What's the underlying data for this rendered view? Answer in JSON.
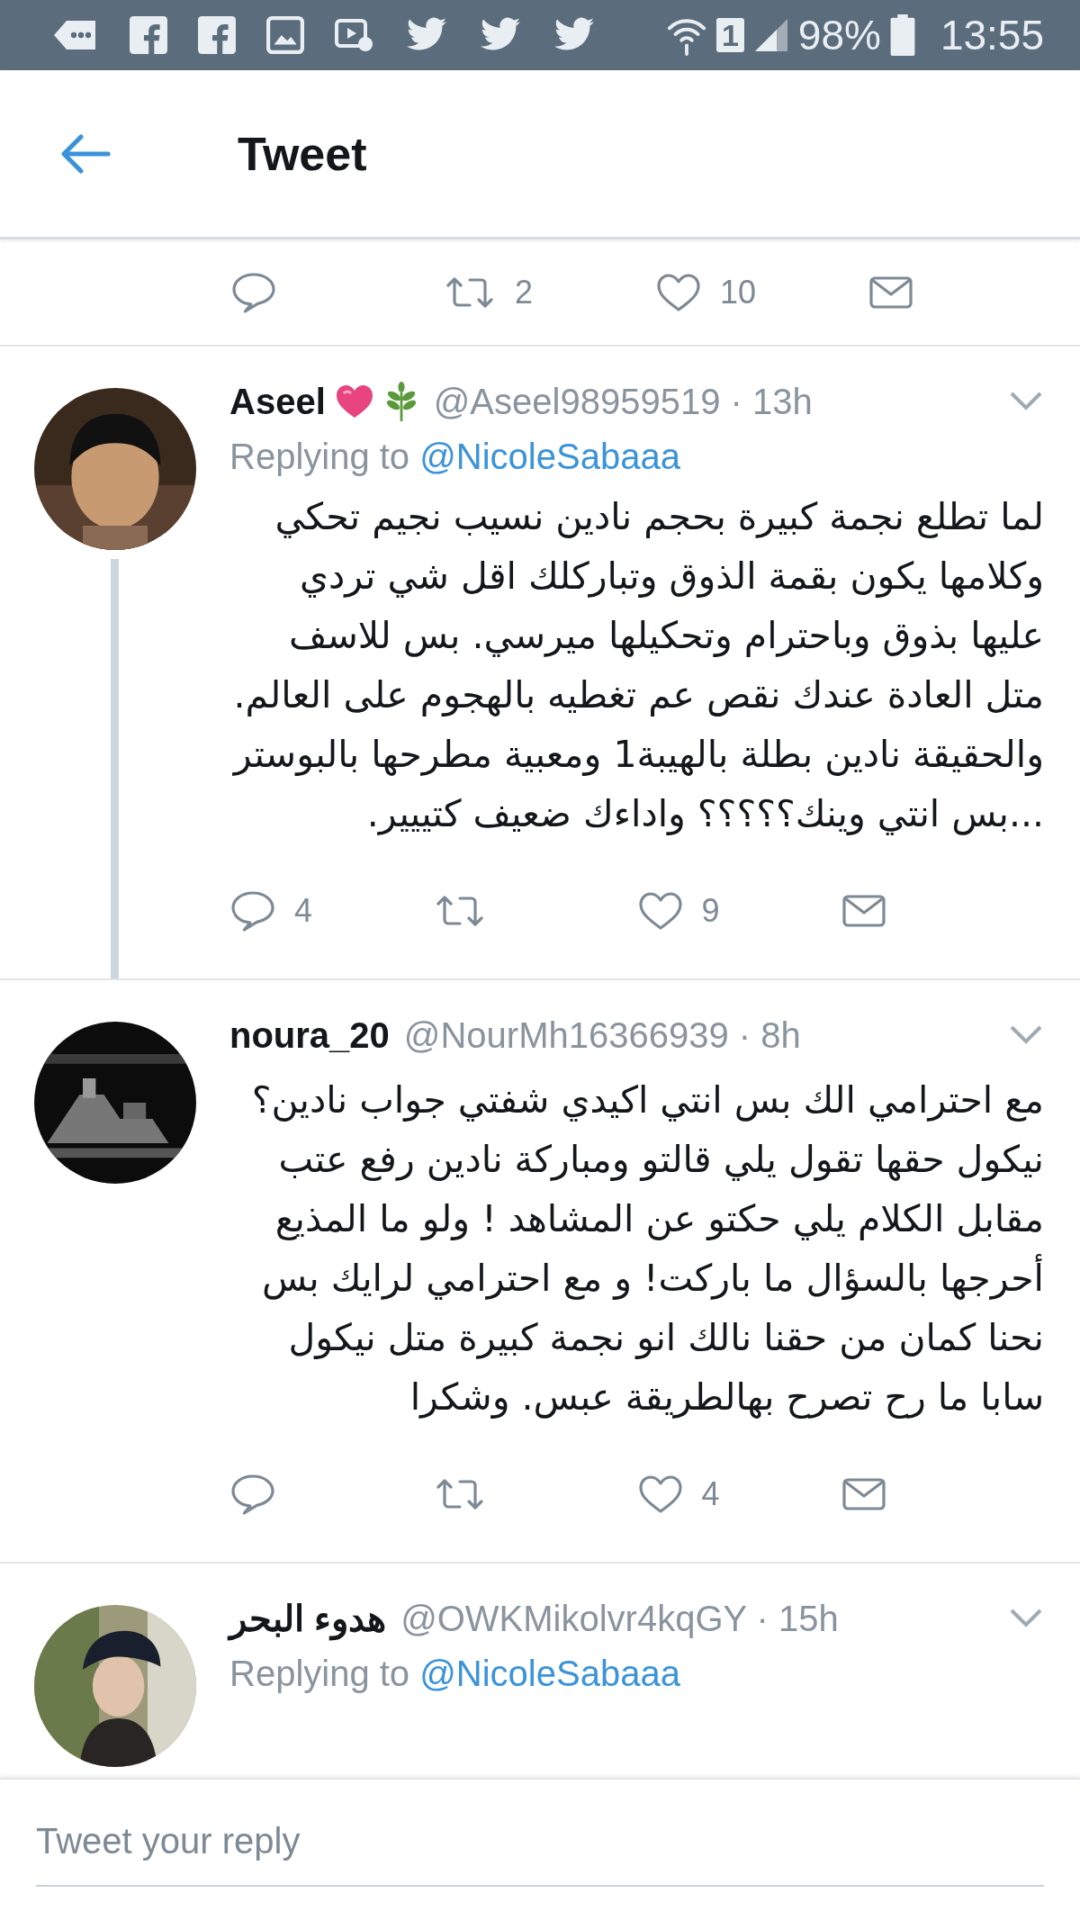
{
  "status_bar": {
    "sim_label": "1",
    "battery": "98%",
    "time": "13:55"
  },
  "header": {
    "title": "Tweet"
  },
  "top_actions": {
    "retweets": "2",
    "likes": "10"
  },
  "tweets": [
    {
      "avatar": {
        "kind": "picture"
      },
      "name": "Aseel",
      "name_icons": [
        {
          "kind": "heart"
        },
        {
          "kind": "sprout"
        }
      ],
      "meta": "@Aseel98959519 · 13h",
      "replying_prefix": "Replying to",
      "replying_to": "@NicoleSabaaa",
      "text": "لما تطلع نجمة كبيرة بحجم نادين نسيب نجيم تحكي وكلامها يكون بقمة الذوق وتباركلك اقل شي تردي عليها بذوق وباحترام وتحكيلها ميرسي. بس للاسف متل العادة عندك نقص عم تغطيه بالهجوم على العالم. والحقيقة نادين بطلة بالهيبة1  ومعبية مطرحها بالبوستر ...بس انتي وينك؟؟؟؟؟ واداءك ضعيف كتييير.",
      "replies": "4",
      "likes": "9",
      "thread_line": true
    },
    {
      "avatar": {
        "kind": "picture"
      },
      "name": "noura_20",
      "meta": "@NourMh16366939 · 8h",
      "text": "مع احترامي الك بس انتي اكيدي شفتي جواب نادين؟ نيكول حقها تقول يلي قالتو ومباركة نادين رفع  عتب مقابل الكلام يلي حكتو عن المشاهد !  ولو ما المذيع أحرجها بالسؤال ما باركت!  و مع  احترامي لرايك بس نحنا كمان من حقنا نالك انو نجمة كبيرة متل نيكول سابا ما رح تصرح بهالطريقة عبس. وشكرا",
      "likes": "4",
      "thread_line": false
    },
    {
      "avatar": {
        "kind": "picture"
      },
      "name": "هدوء البحر",
      "meta": "@OWKMikolvr4kqGY · 15h",
      "replying_prefix": "Replying to",
      "replying_to": "@NicoleSabaaa",
      "thread_line": false
    }
  ],
  "reply_bar": {
    "placeholder": "Tweet your reply"
  }
}
